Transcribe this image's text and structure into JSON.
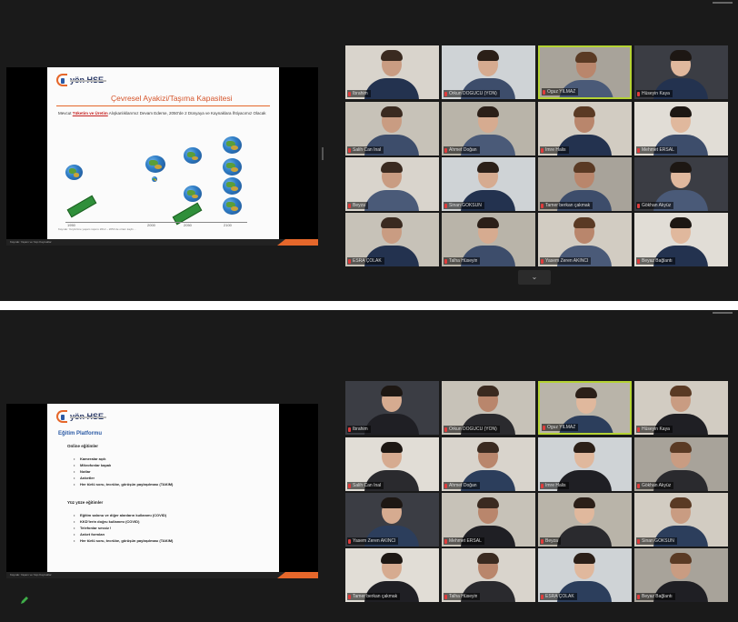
{
  "panels": [
    {
      "slide": {
        "logo_text": "yön HSE",
        "title": "Çevresel Ayakizi/Taşıma Kapasitesi",
        "text_before": "Mevcut ",
        "text_highlight": "Tüketim ve Üretim",
        "text_after": " Alışkanlıklarımız Devam Ederse, 2050'de 2 Dünyaya ve Kaynaklara İhtiyacımız Olacak",
        "years": [
          "1950",
          "2000",
          "2050",
          "2100"
        ],
        "caption": "Kaynak: Yeryüzüne yaşam raporu 2012 – 2050 de ortam kaybı…",
        "footer_text": "Kaynak: Yaşam ve Yapı Kaynaklar"
      },
      "participants": [
        "Ibrahim",
        "Orkun DOĞUCU (YÖN)",
        "Oguz YILMAZ",
        "Hüseyin Kaya",
        "Salih Can İnal",
        "Ahmet Doğan",
        "İmre Halis",
        "Mehmet ERSAL",
        "Beyza",
        "Sinan GÖKSUN",
        "Tamer berkan çakmak",
        "Gökhan Akyüz",
        "ESRA ÇOLAK",
        "Talha Hüseyin",
        "Yasem Zeren AKINCI",
        "Beyaz Bağlantı"
      ],
      "active_speaker_index": 2
    },
    {
      "slide": {
        "logo_text": "yön HSE",
        "title": "Eğitim Platformu",
        "sections": [
          {
            "heading": "Online eğitimler",
            "items": [
              "Kameralar açık",
              "Mikrofonlar kapalı",
              "Notlar",
              "Anketler",
              "Her türlü soru, tecrübe, görüşün paylaşılması (TAKIM)"
            ]
          },
          {
            "heading": "Yüz yüze eğitimler",
            "items": [
              "Eğitim salonu ve diğer alanların kullanımı (COVID)",
              "KKD'lerin doğru kullanımı (COVID)",
              "Telefonlar sessiz !",
              "Anket formları",
              "Her türlü soru, tecrübe, görüşün paylaşılması (TAKIM)"
            ]
          }
        ],
        "footer_text": "Kaynak: Yaşam ve Yapı Kaynaklar"
      },
      "participants": [
        "Ibrahim",
        "Orkun DOĞUCU (YÖN)",
        "Oguz YILMAZ",
        "Hüseyin Kaya",
        "Salih Can İnal",
        "Ahmet Doğan",
        "İmre Halis",
        "Gökhan Akyüz",
        "Yasem Zeren AKINCI",
        "Mehmet ERSAL",
        "Beyza",
        "Sinan GÖKSUN",
        "Tamer berkan çakmak",
        "Talha Hüseyin",
        "ESRA ÇOLAK",
        "Beyaz Bağlantı"
      ],
      "active_speaker_index": 2
    }
  ],
  "more_button_label": "⌄",
  "icons": {
    "mic_muted": "mic-muted-icon",
    "pencil": "pencil-icon"
  },
  "colors": {
    "active_border": "#b5d334",
    "accent": "#e5672b",
    "muted_mic": "#e03c3c"
  }
}
